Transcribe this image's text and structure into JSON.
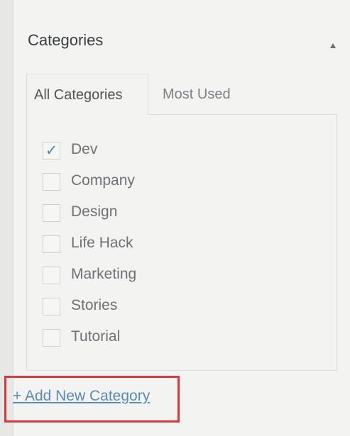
{
  "panel": {
    "title": "Categories"
  },
  "tabs": [
    {
      "label": "All Categories",
      "active": true
    },
    {
      "label": "Most Used",
      "active": false
    }
  ],
  "categories": [
    {
      "label": "Dev",
      "checked": true,
      "mark": "✓"
    },
    {
      "label": "Company",
      "checked": false,
      "mark": ""
    },
    {
      "label": "Design",
      "checked": false,
      "mark": ""
    },
    {
      "label": "Life Hack",
      "checked": false,
      "mark": ""
    },
    {
      "label": "Marketing",
      "checked": false,
      "mark": ""
    },
    {
      "label": "Stories",
      "checked": false,
      "mark": ""
    },
    {
      "label": "Tutorial",
      "checked": false,
      "mark": ""
    }
  ],
  "add_link": {
    "label": "+ Add New Category",
    "highlight_color": "#d33a44"
  },
  "colors": {
    "accent": "#5a8ab8",
    "check": "#4c86b5"
  }
}
